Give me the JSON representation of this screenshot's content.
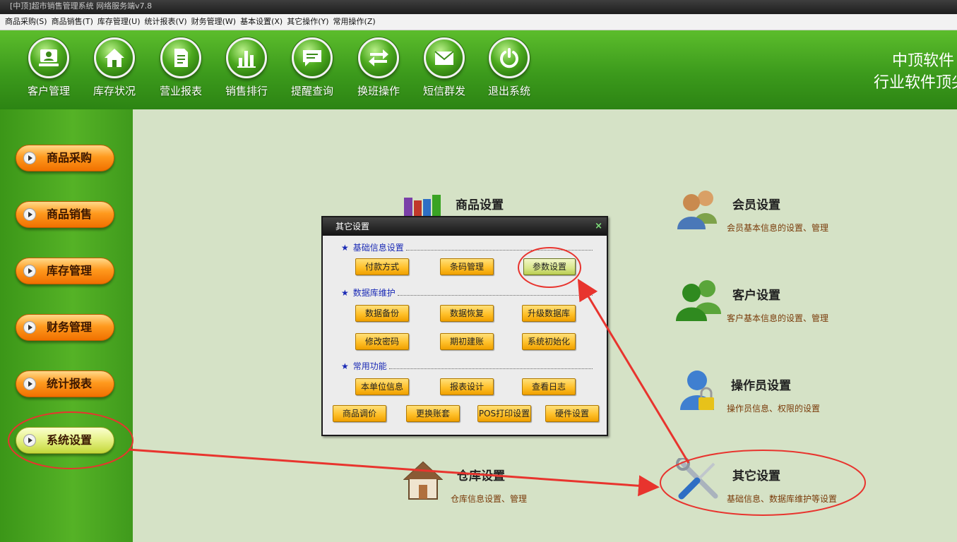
{
  "window": {
    "title": "[中顶]超市销售管理系统 网络服务端v7.8"
  },
  "menu": [
    {
      "name": "menu-purchase",
      "label": "商品采购(S)"
    },
    {
      "name": "menu-sales",
      "label": "商品销售(T)"
    },
    {
      "name": "menu-inventory",
      "label": "库存管理(U)"
    },
    {
      "name": "menu-reports",
      "label": "统计报表(V)"
    },
    {
      "name": "menu-finance",
      "label": "财务管理(W)"
    },
    {
      "name": "menu-basic",
      "label": "基本设置(X)"
    },
    {
      "name": "menu-other",
      "label": "其它操作(Y)"
    },
    {
      "name": "menu-common",
      "label": "常用操作(Z)"
    }
  ],
  "toolbar": [
    {
      "label": "客户管理",
      "icon": "customer-icon"
    },
    {
      "label": "库存状况",
      "icon": "home-icon"
    },
    {
      "label": "营业报表",
      "icon": "document-icon"
    },
    {
      "label": "销售排行",
      "icon": "bar-chart-icon"
    },
    {
      "label": "提醒查询",
      "icon": "message-icon"
    },
    {
      "label": "换班操作",
      "icon": "swap-arrows-icon"
    },
    {
      "label": "短信群发",
      "icon": "mail-icon"
    },
    {
      "label": "退出系统",
      "icon": "power-icon"
    }
  ],
  "brand": {
    "line1": "中顶软件",
    "line2": "行业软件顶尖"
  },
  "sidebar": {
    "items": [
      {
        "label": "商品采购"
      },
      {
        "label": "商品销售"
      },
      {
        "label": "库存管理"
      },
      {
        "label": "财务管理"
      },
      {
        "label": "统计报表"
      },
      {
        "label": "系统设置",
        "active": true
      }
    ]
  },
  "settings": {
    "product": {
      "title": "商品设置"
    },
    "member": {
      "title": "会员设置",
      "desc": "会员基本信息的设置、管理"
    },
    "customer": {
      "title": "客户设置",
      "desc": "客户基本信息的设置、管理"
    },
    "operator": {
      "title": "操作员设置",
      "desc": "操作员信息、权限的设置"
    },
    "warehouse": {
      "title": "仓库设置",
      "desc": "仓库信息设置、管理"
    },
    "other": {
      "title": "其它设置",
      "desc": "基础信息、数据库维护等设置"
    }
  },
  "dialog": {
    "title": "其它设置",
    "close": "×",
    "sections": {
      "basic": "基础信息设置",
      "db": "数据库维护",
      "common": "常用功能"
    },
    "buttons": {
      "payment": "付款方式",
      "barcode": "条码管理",
      "params": "参数设置",
      "backup": "数据备份",
      "restore": "数据恢复",
      "upgrade": "升级数据库",
      "password": "修改密码",
      "opening": "期初建账",
      "init": "系统初始化",
      "unit": "本单位信息",
      "report_design": "报表设计",
      "log": "查看日志",
      "price_adjust": "商品调价",
      "switch_account": "更换账套",
      "pos_print": "POS打印设置",
      "hardware": "硬件设置"
    }
  },
  "colors": {
    "green": "#3c9a1c",
    "content_bg": "#d5e2c6",
    "orange": "#ff9a1e",
    "annotation_red": "#e8342e"
  }
}
